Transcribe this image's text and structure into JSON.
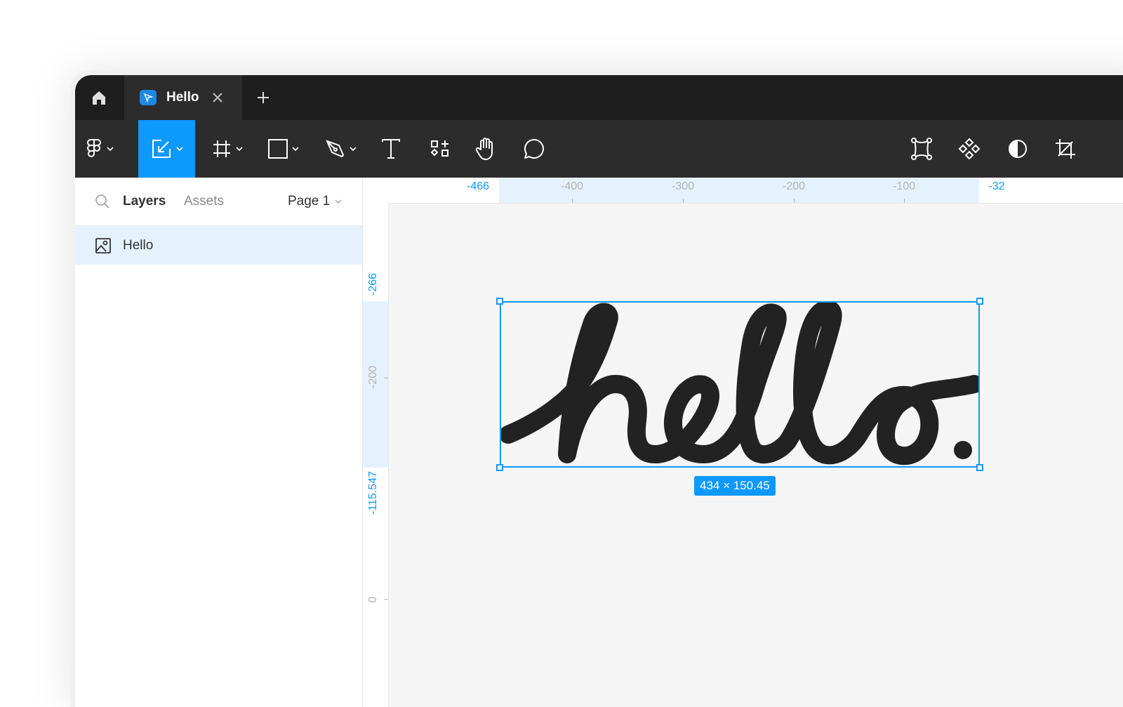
{
  "titlebar": {
    "tab": {
      "label": "Hello",
      "icon": "figma-file-icon"
    },
    "new_tab_label": "+"
  },
  "toolbar": {
    "tools": [
      {
        "name": "main-menu",
        "icon": "figma-logo-icon"
      },
      {
        "name": "move",
        "icon": "move-icon",
        "active": true
      },
      {
        "name": "frame",
        "icon": "frame-icon"
      },
      {
        "name": "shape",
        "icon": "rectangle-icon"
      },
      {
        "name": "pen",
        "icon": "pen-icon"
      },
      {
        "name": "text",
        "icon": "text-icon"
      },
      {
        "name": "resources",
        "icon": "resources-icon"
      },
      {
        "name": "hand",
        "icon": "hand-icon"
      },
      {
        "name": "comment",
        "icon": "comment-icon"
      }
    ],
    "right_tools": [
      {
        "name": "edit-object",
        "icon": "edit-object-icon"
      },
      {
        "name": "component",
        "icon": "component-icon"
      },
      {
        "name": "mask",
        "icon": "mask-icon"
      },
      {
        "name": "crop",
        "icon": "crop-icon"
      }
    ],
    "accent": "#0d99ff"
  },
  "sidebar": {
    "tabs": {
      "layers": "Layers",
      "assets": "Assets"
    },
    "page": "Page 1",
    "layers": [
      {
        "label": "Hello",
        "icon": "image-icon",
        "selected": true
      }
    ]
  },
  "rulers": {
    "horizontal": {
      "selection_start": "-466",
      "selection_end": "-32",
      "ticks": [
        "-400",
        "-300",
        "-200",
        "-100"
      ]
    },
    "vertical": {
      "selection_start": "-266",
      "selection_end": "-115.547",
      "ticks": [
        "-200",
        "0"
      ]
    }
  },
  "canvas": {
    "artwork_text": "hello.",
    "dimensions": "434 × 150.45"
  }
}
